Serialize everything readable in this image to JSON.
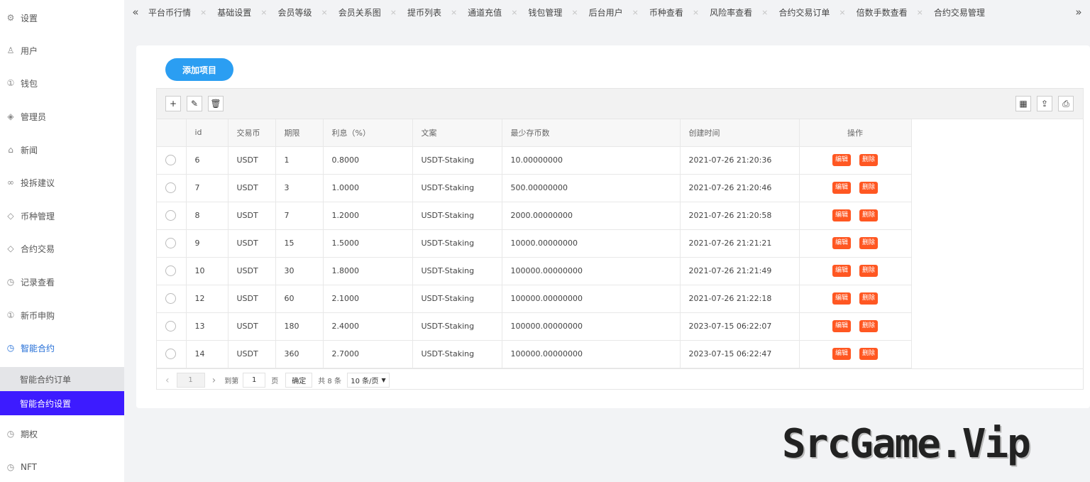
{
  "sidebar": {
    "items": [
      {
        "label": "设置",
        "icon": "gear-icon",
        "glyph": "⚙"
      },
      {
        "label": "用户",
        "icon": "user-icon",
        "glyph": "♙"
      },
      {
        "label": "钱包",
        "icon": "coin-icon",
        "glyph": "①"
      },
      {
        "label": "管理员",
        "icon": "shield-icon",
        "glyph": "◈"
      },
      {
        "label": "新闻",
        "icon": "tag-icon",
        "glyph": "⌂"
      },
      {
        "label": "投拆建议",
        "icon": "link-icon",
        "glyph": "∞"
      },
      {
        "label": "币种管理",
        "icon": "diamond-icon",
        "glyph": "◇"
      },
      {
        "label": "合约交易",
        "icon": "diamond-icon",
        "glyph": "◇"
      },
      {
        "label": "记录查看",
        "icon": "clock-icon",
        "glyph": "◷"
      },
      {
        "label": "新币申购",
        "icon": "coin-icon",
        "glyph": "①"
      },
      {
        "label": "智能合约",
        "icon": "clock-icon",
        "glyph": "◷"
      }
    ],
    "subitems": [
      {
        "label": "智能合约订单"
      },
      {
        "label": "智能合约设置"
      }
    ],
    "bottom_items": [
      {
        "label": "期权",
        "icon": "clock-icon",
        "glyph": "◷"
      },
      {
        "label": "NFT",
        "icon": "clock-icon",
        "glyph": "◷"
      }
    ]
  },
  "tabs": {
    "prev_glyph": "«",
    "next_glyph": "»",
    "close_glyph": "×",
    "items": [
      "平台币行情",
      "基础设置",
      "会员等级",
      "会员关系图",
      "提币列表",
      "通道充值",
      "钱包管理",
      "后台用户",
      "币种查看",
      "风险率查看",
      "合约交易订单",
      "倍数手数查看",
      "合约交易管理"
    ]
  },
  "main": {
    "add_button": "添加项目",
    "toolbar": {
      "add": "+",
      "edit": "✎",
      "delete": "🗑",
      "cols": "▦",
      "export": "⇪",
      "print": "⎙"
    },
    "columns": [
      "id",
      "交易币",
      "期限",
      "利息（%）",
      "文案",
      "最少存币数",
      "创建时间",
      "操作"
    ],
    "rows": [
      {
        "id": "6",
        "coin": "USDT",
        "term": "1",
        "rate": "0.8000",
        "text": "USDT-Staking",
        "min": "10.00000000",
        "created": "2021-07-26 21:20:36"
      },
      {
        "id": "7",
        "coin": "USDT",
        "term": "3",
        "rate": "1.0000",
        "text": "USDT-Staking",
        "min": "500.00000000",
        "created": "2021-07-26 21:20:46"
      },
      {
        "id": "8",
        "coin": "USDT",
        "term": "7",
        "rate": "1.2000",
        "text": "USDT-Staking",
        "min": "2000.00000000",
        "created": "2021-07-26 21:20:58"
      },
      {
        "id": "9",
        "coin": "USDT",
        "term": "15",
        "rate": "1.5000",
        "text": "USDT-Staking",
        "min": "10000.00000000",
        "created": "2021-07-26 21:21:21"
      },
      {
        "id": "10",
        "coin": "USDT",
        "term": "30",
        "rate": "1.8000",
        "text": "USDT-Staking",
        "min": "100000.00000000",
        "created": "2021-07-26 21:21:49"
      },
      {
        "id": "12",
        "coin": "USDT",
        "term": "60",
        "rate": "2.1000",
        "text": "USDT-Staking",
        "min": "100000.00000000",
        "created": "2021-07-26 21:22:18"
      },
      {
        "id": "13",
        "coin": "USDT",
        "term": "180",
        "rate": "2.4000",
        "text": "USDT-Staking",
        "min": "100000.00000000",
        "created": "2023-07-15 06:22:07"
      },
      {
        "id": "14",
        "coin": "USDT",
        "term": "360",
        "rate": "2.7000",
        "text": "USDT-Staking",
        "min": "100000.00000000",
        "created": "2023-07-15 06:22:47"
      }
    ],
    "row_actions": {
      "edit": "编辑",
      "delete": "删除"
    },
    "pager": {
      "prev": "‹",
      "current": "1",
      "next": "›",
      "goto_label": "到第",
      "goto_value": "1",
      "page_unit": "页",
      "confirm": "确定",
      "total": "共 8 条",
      "page_size": "10 条/页"
    }
  },
  "watermark": "SrcGame.Vip",
  "colors": {
    "accent": "#2b9ef2",
    "selected": "#3d1bff",
    "action": "#ff5722"
  }
}
